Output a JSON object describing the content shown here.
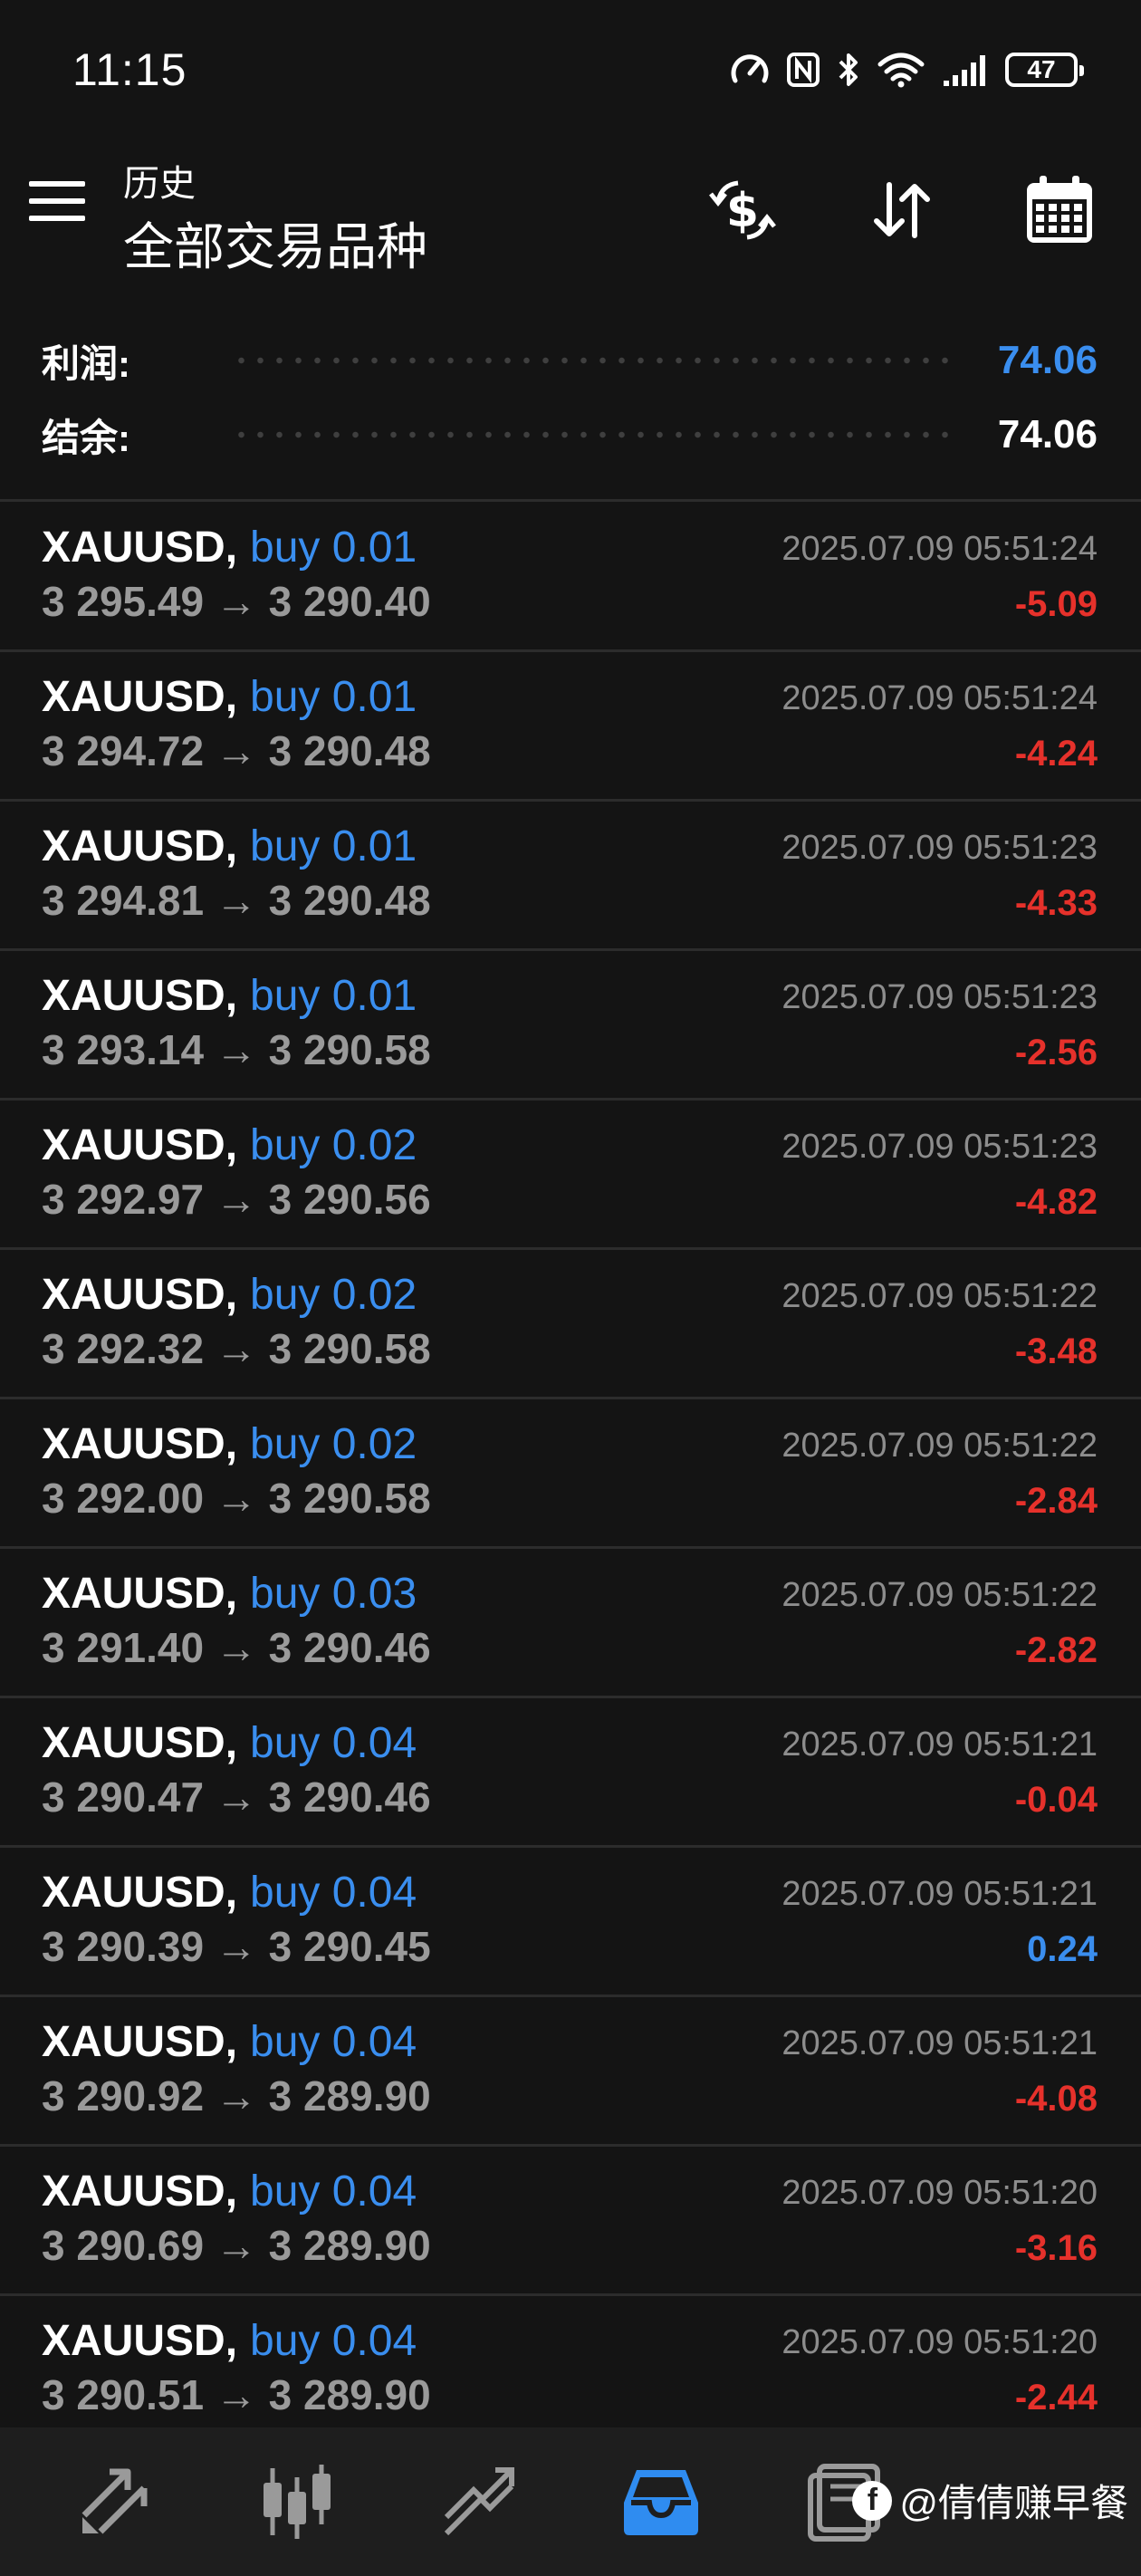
{
  "status_bar": {
    "time": "11:15",
    "battery": "47",
    "icons": [
      "speed-icon",
      "nfc-icon",
      "bluetooth-icon",
      "wifi-icon",
      "signal-icon",
      "battery-icon"
    ]
  },
  "header": {
    "subtitle": "历史",
    "title": "全部交易品种",
    "actions": [
      "currency-swap-icon",
      "sort-icon",
      "calendar-icon"
    ]
  },
  "summary": {
    "profit_label": "利润:",
    "profit_value": "74.06",
    "balance_label": "结余:",
    "balance_value": "74.06"
  },
  "colors": {
    "accent": "#3a8eef",
    "loss": "#e6312b",
    "background": "#141414"
  },
  "trades": [
    {
      "symbol": "XAUUSD,",
      "side": "buy 0.01",
      "open": "3 295.49",
      "close": "3 290.40",
      "time": "2025.07.09 05:51:24",
      "profit": "-5.09"
    },
    {
      "symbol": "XAUUSD,",
      "side": "buy 0.01",
      "open": "3 294.72",
      "close": "3 290.48",
      "time": "2025.07.09 05:51:24",
      "profit": "-4.24"
    },
    {
      "symbol": "XAUUSD,",
      "side": "buy 0.01",
      "open": "3 294.81",
      "close": "3 290.48",
      "time": "2025.07.09 05:51:23",
      "profit": "-4.33"
    },
    {
      "symbol": "XAUUSD,",
      "side": "buy 0.01",
      "open": "3 293.14",
      "close": "3 290.58",
      "time": "2025.07.09 05:51:23",
      "profit": "-2.56"
    },
    {
      "symbol": "XAUUSD,",
      "side": "buy 0.02",
      "open": "3 292.97",
      "close": "3 290.56",
      "time": "2025.07.09 05:51:23",
      "profit": "-4.82"
    },
    {
      "symbol": "XAUUSD,",
      "side": "buy 0.02",
      "open": "3 292.32",
      "close": "3 290.58",
      "time": "2025.07.09 05:51:22",
      "profit": "-3.48"
    },
    {
      "symbol": "XAUUSD,",
      "side": "buy 0.02",
      "open": "3 292.00",
      "close": "3 290.58",
      "time": "2025.07.09 05:51:22",
      "profit": "-2.84"
    },
    {
      "symbol": "XAUUSD,",
      "side": "buy 0.03",
      "open": "3 291.40",
      "close": "3 290.46",
      "time": "2025.07.09 05:51:22",
      "profit": "-2.82"
    },
    {
      "symbol": "XAUUSD,",
      "side": "buy 0.04",
      "open": "3 290.47",
      "close": "3 290.46",
      "time": "2025.07.09 05:51:21",
      "profit": "-0.04"
    },
    {
      "symbol": "XAUUSD,",
      "side": "buy 0.04",
      "open": "3 290.39",
      "close": "3 290.45",
      "time": "2025.07.09 05:51:21",
      "profit": "0.24"
    },
    {
      "symbol": "XAUUSD,",
      "side": "buy 0.04",
      "open": "3 290.92",
      "close": "3 289.90",
      "time": "2025.07.09 05:51:21",
      "profit": "-4.08"
    },
    {
      "symbol": "XAUUSD,",
      "side": "buy 0.04",
      "open": "3 290.69",
      "close": "3 289.90",
      "time": "2025.07.09 05:51:20",
      "profit": "-3.16"
    },
    {
      "symbol": "XAUUSD,",
      "side": "buy 0.04",
      "open": "3 290.51",
      "close": "3 289.90",
      "time": "2025.07.09 05:51:20",
      "profit": "-2.44"
    }
  ],
  "bottom_nav": {
    "items": [
      "quotes-icon",
      "chart-icon",
      "trade-icon",
      "history-icon",
      "messages-icon"
    ],
    "active": "history-icon"
  },
  "watermark": {
    "logo": "f",
    "text": "@倩倩赚早餐"
  }
}
